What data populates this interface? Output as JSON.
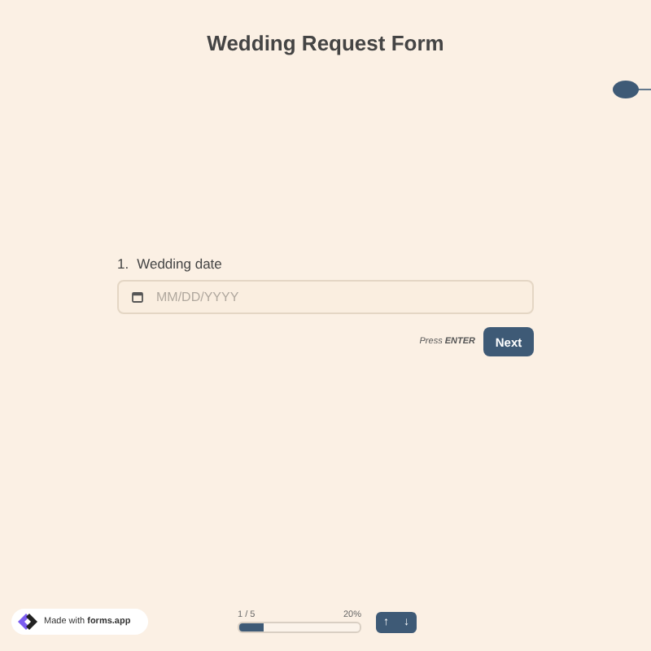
{
  "title": "Wedding Request Form",
  "question": {
    "number": "1.",
    "label": "Wedding date",
    "placeholder": "MM/DD/YYYY"
  },
  "hint": {
    "prefix": "Press",
    "key": "ENTER"
  },
  "next_button": "Next",
  "badge": {
    "text": "Made with **forms.app**"
  },
  "progress": {
    "count": "1 / 5",
    "percent": "20%",
    "level": 0.2
  },
  "nav": {
    "up": "↑",
    "down": "↓"
  }
}
